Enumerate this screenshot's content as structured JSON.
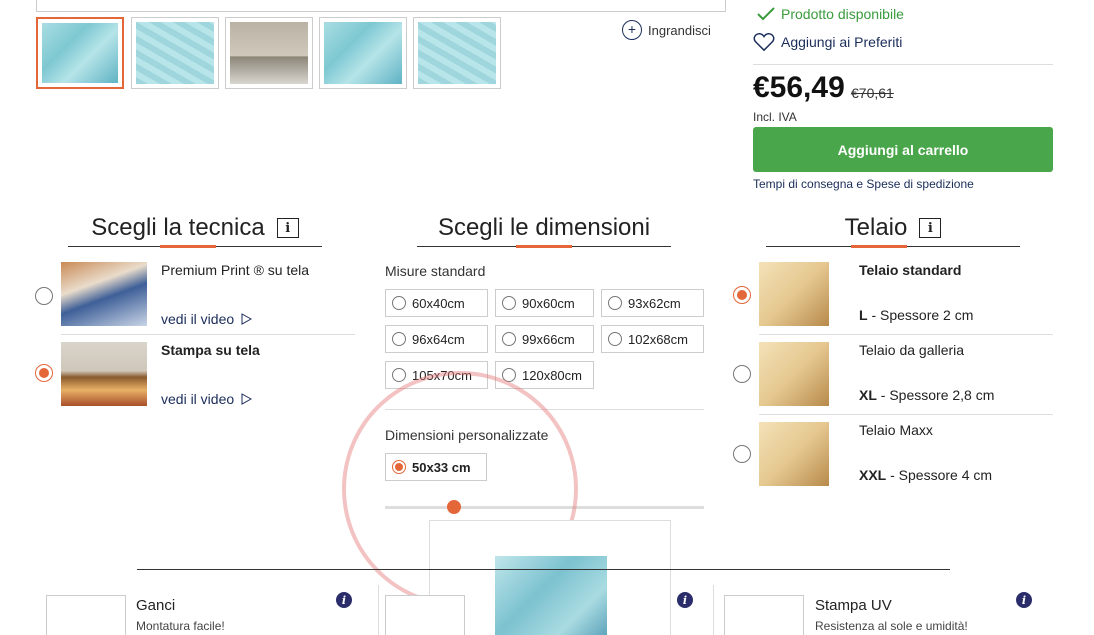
{
  "gallery": {
    "thumbnails": [
      "map-world-light",
      "map-world-blue",
      "room-view",
      "map-asia",
      "map-europe"
    ],
    "zoom_label": "Ingrandisci"
  },
  "buy": {
    "availability": "Prodotto disponibile",
    "favorites": "Aggiungi ai Preferiti",
    "price": "€56,49",
    "old_price": "€70,61",
    "vat": "Incl. IVA",
    "cart_button": "Aggiungi al carrello",
    "shipping_link": "Tempi di consegna e Spese di spedizione"
  },
  "technique": {
    "title": "Scegli la tecnica",
    "info": "i",
    "options": [
      {
        "name_prefix": "Premium Print ® su tela",
        "video": "vedi il video",
        "selected": false
      },
      {
        "name_prefix": "Stampa su tela",
        "video": "vedi il video",
        "selected": true
      }
    ]
  },
  "dimensions": {
    "title": "Scegli le dimensioni",
    "standard_label": "Misure standard",
    "sizes": [
      "60x40cm",
      "90x60cm",
      "93x62cm",
      "96x64cm",
      "99x66cm",
      "102x68cm",
      "105x70cm",
      "120x80cm"
    ],
    "custom_label": "Dimensioni personalizzate",
    "custom_value": "50x33 cm"
  },
  "frame": {
    "title": "Telaio",
    "info": "i",
    "options": [
      {
        "name": "Telaio standard",
        "size": "L",
        "desc": " - Spessore 2 cm",
        "selected": true
      },
      {
        "name": "Telaio da galleria",
        "size": "XL",
        "desc": " - Spessore 2,8 cm",
        "selected": false
      },
      {
        "name": "Telaio Maxx",
        "size": "XXL",
        "desc": " - Spessore 4 cm",
        "selected": false
      }
    ]
  },
  "extras": [
    {
      "title": "Ganci",
      "subtitle": "Montatura facile!",
      "info": "i"
    },
    {
      "title": "",
      "subtitle": "",
      "info": "i"
    },
    {
      "title": "Stampa UV",
      "subtitle": "Resistenza al sole e umidità!",
      "info": "i"
    }
  ],
  "colors": {
    "accent": "#e4673a",
    "green": "#4aa64b",
    "navy": "#1a2d5a"
  }
}
